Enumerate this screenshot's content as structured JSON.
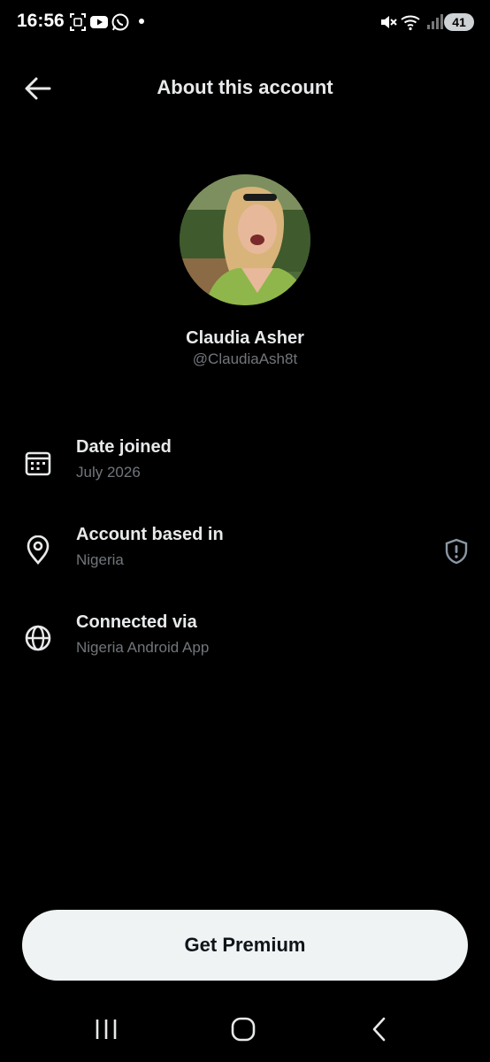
{
  "status_bar": {
    "time": "16:56",
    "battery": "41",
    "icons": [
      "screenshot-icon",
      "youtube-icon",
      "whatsapp-icon",
      "dot-icon",
      "mute-icon",
      "wifi-icon",
      "signal-icon",
      "battery-icon"
    ]
  },
  "header": {
    "title": "About this account",
    "back_icon": "arrow-left-icon"
  },
  "profile": {
    "name": "Claudia Asher",
    "handle": "@ClaudiaAsh8t"
  },
  "info": [
    {
      "icon": "calendar-icon",
      "label": "Date joined",
      "value": "July 2026"
    },
    {
      "icon": "location-pin-icon",
      "label": "Account based in",
      "value": "Nigeria",
      "badge_icon": "shield-alert-icon"
    },
    {
      "icon": "globe-icon",
      "label": "Connected via",
      "value": "Nigeria Android App"
    }
  ],
  "premium_button": {
    "label": "Get Premium"
  },
  "nav_bar": {
    "icons": [
      "recent-apps-icon",
      "home-icon",
      "back-icon"
    ]
  },
  "colors": {
    "background": "#000000",
    "primary_text": "#e7e9ea",
    "secondary_text": "#71767b",
    "button_bg": "#eff3f4"
  }
}
